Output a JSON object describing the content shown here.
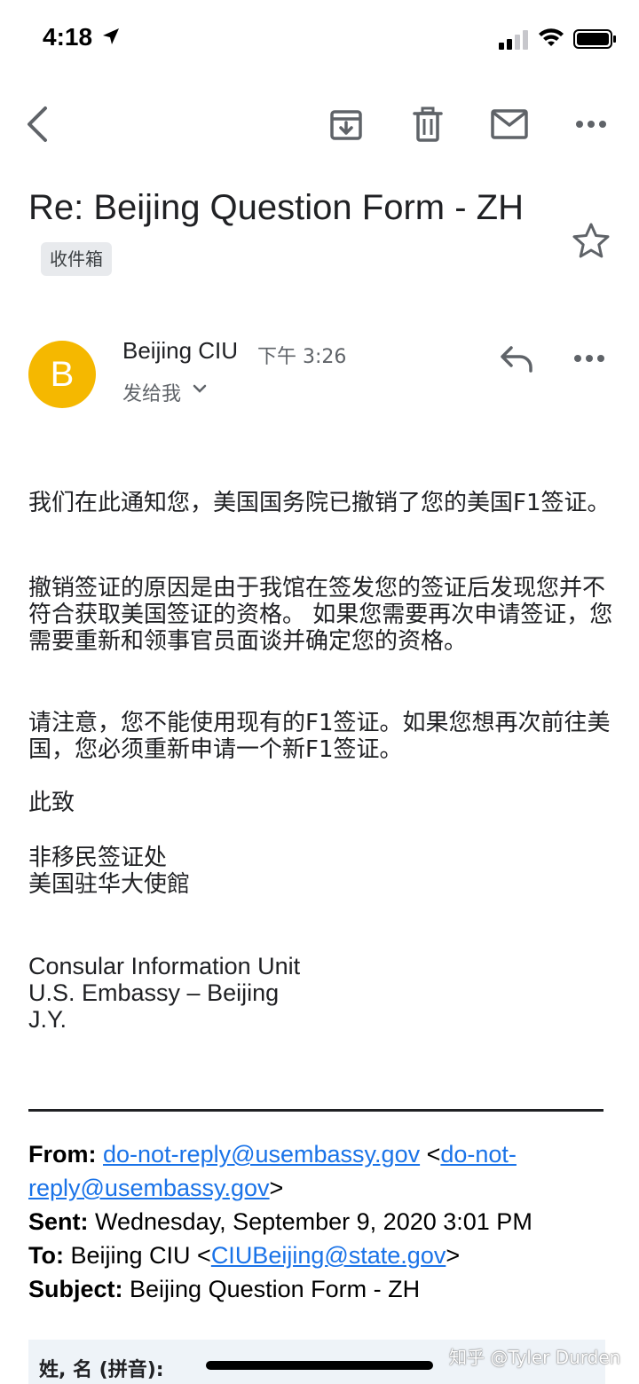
{
  "status_bar": {
    "time": "4:18"
  },
  "message": {
    "subject": "Re: Beijing Question Form - ZH",
    "label": "收件箱",
    "sender": {
      "initial": "B",
      "name": "Beijing CIU",
      "time": "下午 3:26",
      "to": "发给我",
      "avatar_color": "#f5b800"
    },
    "body": {
      "p1": "我们在此通知您，美国国务院已撤销了您的美国F1签证。",
      "p2": "撤销签证的原因是由于我馆在签发您的签证后发现您并不符合获取美国签证的资格。 如果您需要再次申请签证，您需要重新和领事官员面谈并确定您的资格。",
      "p3": "请注意，您不能使用现有的F1签证。如果您想再次前往美国，您必须重新申请一个新F1签证。",
      "p4": "此致",
      "p5_line1": "非移民签证处",
      "p5_line2": "美国驻华大使館",
      "p6_line1": "Consular Information Unit",
      "p6_line2": "U.S. Embassy – Beijing",
      "p6_line3": "J.Y."
    },
    "original_header": {
      "from_label": "From:",
      "from_link1": "do-not-reply@usembassy.gov",
      "from_mid": " <",
      "from_link2": "do-not-reply@usembassy.gov",
      "from_end": ">",
      "sent_label": "Sent:",
      "sent_value": " Wednesday, September 9, 2020 3:01 PM",
      "to_label": "To:",
      "to_value": " Beijing CIU <",
      "to_link": "CIUBeijing@state.gov",
      "to_end": ">",
      "subject_label": "Subject:",
      "subject_value": " Beijing Question Form - ZH"
    },
    "form_label": "姓, 名 (拼音):"
  },
  "watermark": "知乎 @Tyler Durden",
  "icons": [
    "back-arrow-icon",
    "archive-icon",
    "trash-icon",
    "mail-icon",
    "more-icon",
    "star-icon",
    "reply-icon",
    "chevron-down-icon"
  ]
}
